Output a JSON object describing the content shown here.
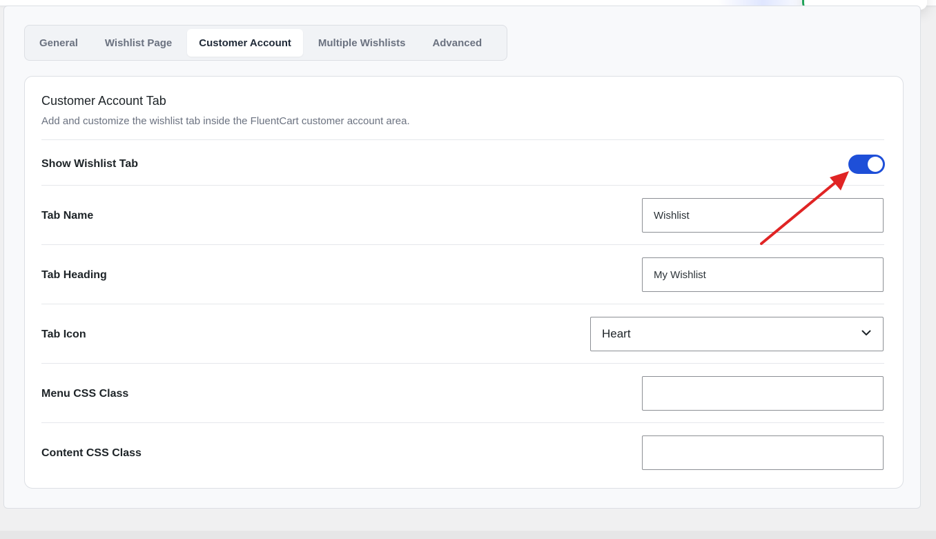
{
  "tabs": [
    {
      "label": "General",
      "active": false
    },
    {
      "label": "Wishlist Page",
      "active": false
    },
    {
      "label": "Customer Account",
      "active": true
    },
    {
      "label": "Multiple Wishlists",
      "active": false
    },
    {
      "label": "Advanced",
      "active": false
    }
  ],
  "section": {
    "title": "Customer Account Tab",
    "description": "Add and customize the wishlist tab inside the FluentCart customer account area."
  },
  "fields": {
    "show_tab": {
      "label": "Show Wishlist Tab",
      "enabled": true
    },
    "tab_name": {
      "label": "Tab Name",
      "value": "Wishlist"
    },
    "tab_heading": {
      "label": "Tab Heading",
      "value": "My Wishlist"
    },
    "tab_icon": {
      "label": "Tab Icon",
      "selected": "Heart"
    },
    "menu_css": {
      "label": "Menu CSS Class",
      "value": ""
    },
    "content_css": {
      "label": "Content CSS Class",
      "value": ""
    }
  },
  "colors": {
    "toggle_on": "#1e4fd8",
    "annotation_arrow": "#e02424",
    "toast_accent": "#22a35a"
  },
  "icons": {
    "select_arrow": "chevron-down-icon",
    "annotation": "red-arrow-icon"
  }
}
